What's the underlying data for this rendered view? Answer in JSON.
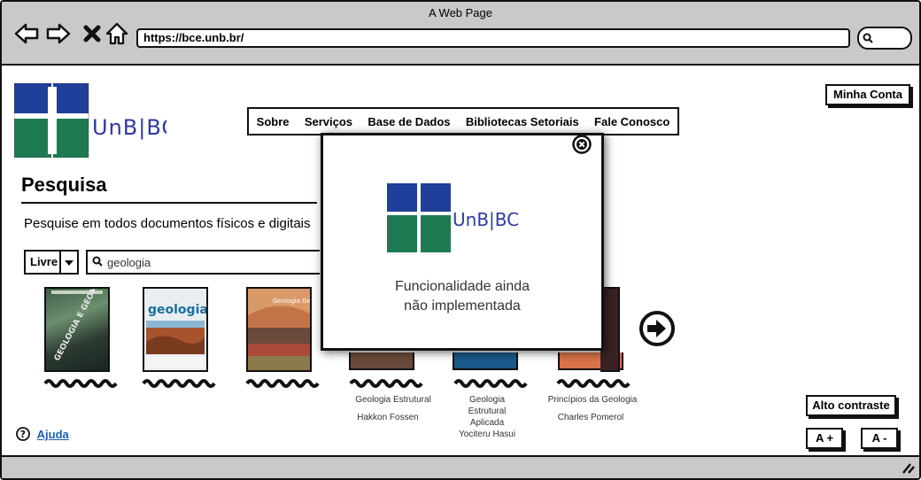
{
  "browser": {
    "window_title": "A Web Page",
    "url": "https://bce.unb.br/"
  },
  "header": {
    "account_label": "Minha Conta",
    "logo_text": "UnB|BCE"
  },
  "menu": {
    "items": [
      "Sobre",
      "Serviços",
      "Base de Dados",
      "Bibliotecas Setoriais",
      "Fale Conosco"
    ]
  },
  "search": {
    "title": "Pesquisa",
    "subtitle": "Pesquise em todos documentos físicos e digitais",
    "mode": "Livre",
    "query": "geologia"
  },
  "books": [
    {
      "title": "",
      "author": ""
    },
    {
      "title": "",
      "author": ""
    },
    {
      "title": "",
      "author": ""
    },
    {
      "title": "Geologia Estrutural",
      "author": "Hakkon Fossen"
    },
    {
      "title": "Geologia Estrutural Aplicada",
      "author": "Yociteru Hasui"
    },
    {
      "title": "Princípios da Geologia",
      "author": "Charles Pomerol"
    }
  ],
  "cover_titles": {
    "book1": "GEOLOGIA E GEOMORFOLOGIA",
    "book2": "geologia",
    "book3": "Geologia Geral"
  },
  "popup": {
    "message_line1": "Funcionalidade ainda",
    "message_line2": "não implementada"
  },
  "accessibility": {
    "contrast_label": "Alto contraste",
    "font_increase_label": "A +",
    "font_decrease_label": "A -"
  },
  "help": {
    "label": "Ajuda"
  },
  "colors": {
    "chrome": "#c9c9c9",
    "logo_blue": "#1f3f9a",
    "logo_green": "#1e7a52"
  }
}
